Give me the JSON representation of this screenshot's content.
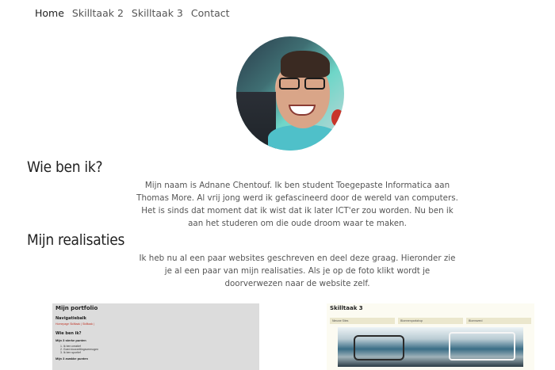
{
  "nav": {
    "items": [
      {
        "label": "Home",
        "active": true
      },
      {
        "label": "Skilltaak 2",
        "active": false
      },
      {
        "label": "Skilltaak 3",
        "active": false
      },
      {
        "label": "Contact",
        "active": false
      }
    ]
  },
  "about": {
    "heading": "Wie ben ik?",
    "text": "Mijn naam is Adnane Chentouf. Ik ben student Toegepaste Informatica aan Thomas More. Al vrij jong werd ik gefascineerd door de wereld van computers. Het is sinds dat moment dat ik wist dat ik later ICT'er zou worden. Nu ben ik aan het studeren om die oude droom waar te maken."
  },
  "projects": {
    "heading": "Mijn realisaties",
    "text": "Ik heb nu al een paar websites geschreven en deel deze graag. Hieronder zie je al een paar van mijn realisaties. Als je op de foto klikt wordt je doorverwezen naar de website zelf.",
    "thumb1": {
      "title": "Mijn portfolio",
      "nav_heading": "Navigatiebalk",
      "nav_links": "Homepage  Skilltaak  |  Skilltaak  |",
      "about_heading": "Wie ben ik?",
      "strong_heading": "Mijn 3 sterke punten",
      "strong_items": [
        "1. Ik ben creatief",
        "2. Goed doorzettingsvermogen",
        "3. Ik ben sportief"
      ],
      "weak_heading": "Mijn 3 zwakke punten"
    },
    "thumb2": {
      "title": "Skilltaak 3",
      "tabs": [
        "Nieuwe Sites",
        "Bloemenparkshop",
        "Bloemwerd"
      ]
    }
  },
  "colors": {
    "thumb1_links": "#c0392b",
    "thumb2_bg": "#fcfbf2"
  }
}
